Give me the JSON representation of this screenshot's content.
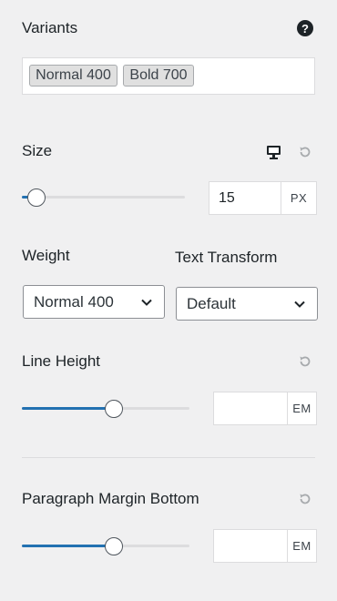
{
  "variants": {
    "label": "Variants",
    "help_icon": "question-circle-icon",
    "chips": [
      "Normal 400",
      "Bold 700"
    ]
  },
  "size": {
    "label": "Size",
    "device_icon": "desktop-icon",
    "reset_icon": "reset-icon",
    "value": "15",
    "unit": "PX",
    "slider_fraction": 0.09
  },
  "weight": {
    "label": "Weight",
    "selected": "Normal 400"
  },
  "text_transform": {
    "label": "Text Transform",
    "selected": "Default"
  },
  "line_height": {
    "label": "Line Height",
    "reset_icon": "reset-icon",
    "value": "",
    "unit": "EM",
    "slider_fraction": 0.55
  },
  "paragraph_margin": {
    "label": "Paragraph Margin Bottom",
    "reset_icon": "reset-icon",
    "value": "",
    "unit": "EM",
    "slider_fraction": 0.55
  },
  "colors": {
    "background": "#f0f0f1",
    "accent": "#2271b1",
    "text": "#1d2327"
  }
}
